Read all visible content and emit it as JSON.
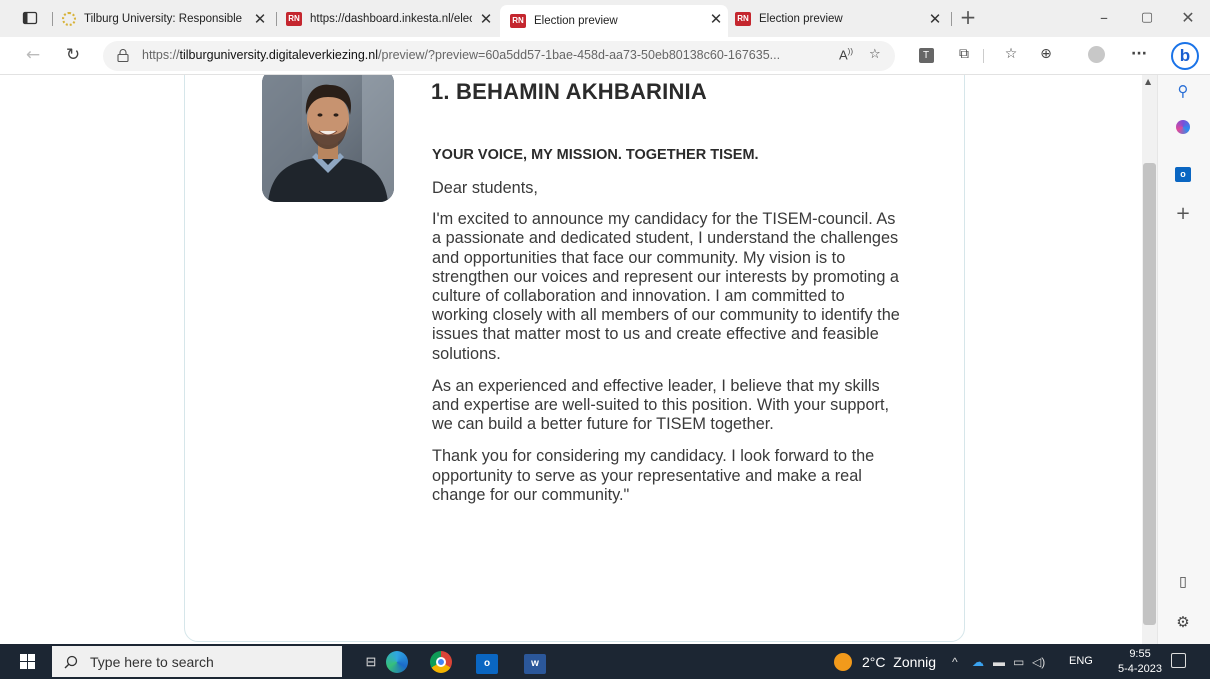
{
  "browser": {
    "tabs": [
      {
        "title": "Tilburg University: Responsible a",
        "favicon": "sun-favicon"
      },
      {
        "title": "https://dashboard.inkesta.nl/elec",
        "favicon": "rn-favicon"
      },
      {
        "title": "Election preview",
        "favicon": "rn-favicon",
        "active": true
      },
      {
        "title": "Election preview",
        "favicon": "rn-favicon"
      }
    ],
    "url_prefix": "https://",
    "url_host": "tilburguniversity.digitaleverkiezing.nl",
    "url_path": "/preview/?preview=60a5dd57-1bae-458d-aa73-50eb80138c60-167635...",
    "read_aloud_label": "A",
    "toolbar_tile_label": "T",
    "more_label": "···",
    "bing_label": "b"
  },
  "candidate": {
    "name": "1. BEHAMIN AKHBARINIA",
    "tagline": "YOUR VOICE, MY MISSION. TOGETHER TISEM.",
    "greeting": "Dear students,",
    "paragraphs": [
      "I'm excited to announce my candidacy for the TISEM-council. As a passionate and dedicated student, I understand the challenges and opportunities that face our community. My vision is to strengthen our voices and represent our interests by promoting a culture of collaboration and innovation. I am committed to working closely with all members of our community to identify the issues that matter most to us and create effective and feasible solutions.",
      "As an experienced and effective leader, I believe that my skills and expertise are well-suited to this position. With your support, we can build a better future for TISEM together.",
      "Thank you for considering my candidacy. I look forward to the opportunity to serve as your representative and make a real change for our community.\""
    ]
  },
  "taskbar": {
    "search_placeholder": "Type here to search",
    "weather": "2°C  Zonnig",
    "language": "ENG",
    "time": "9:55",
    "date": "5-4-2023"
  },
  "colors": {
    "taskbar_bg": "#1c2633",
    "accent": "#1a73e8",
    "favicon_red": "#c4262e"
  }
}
